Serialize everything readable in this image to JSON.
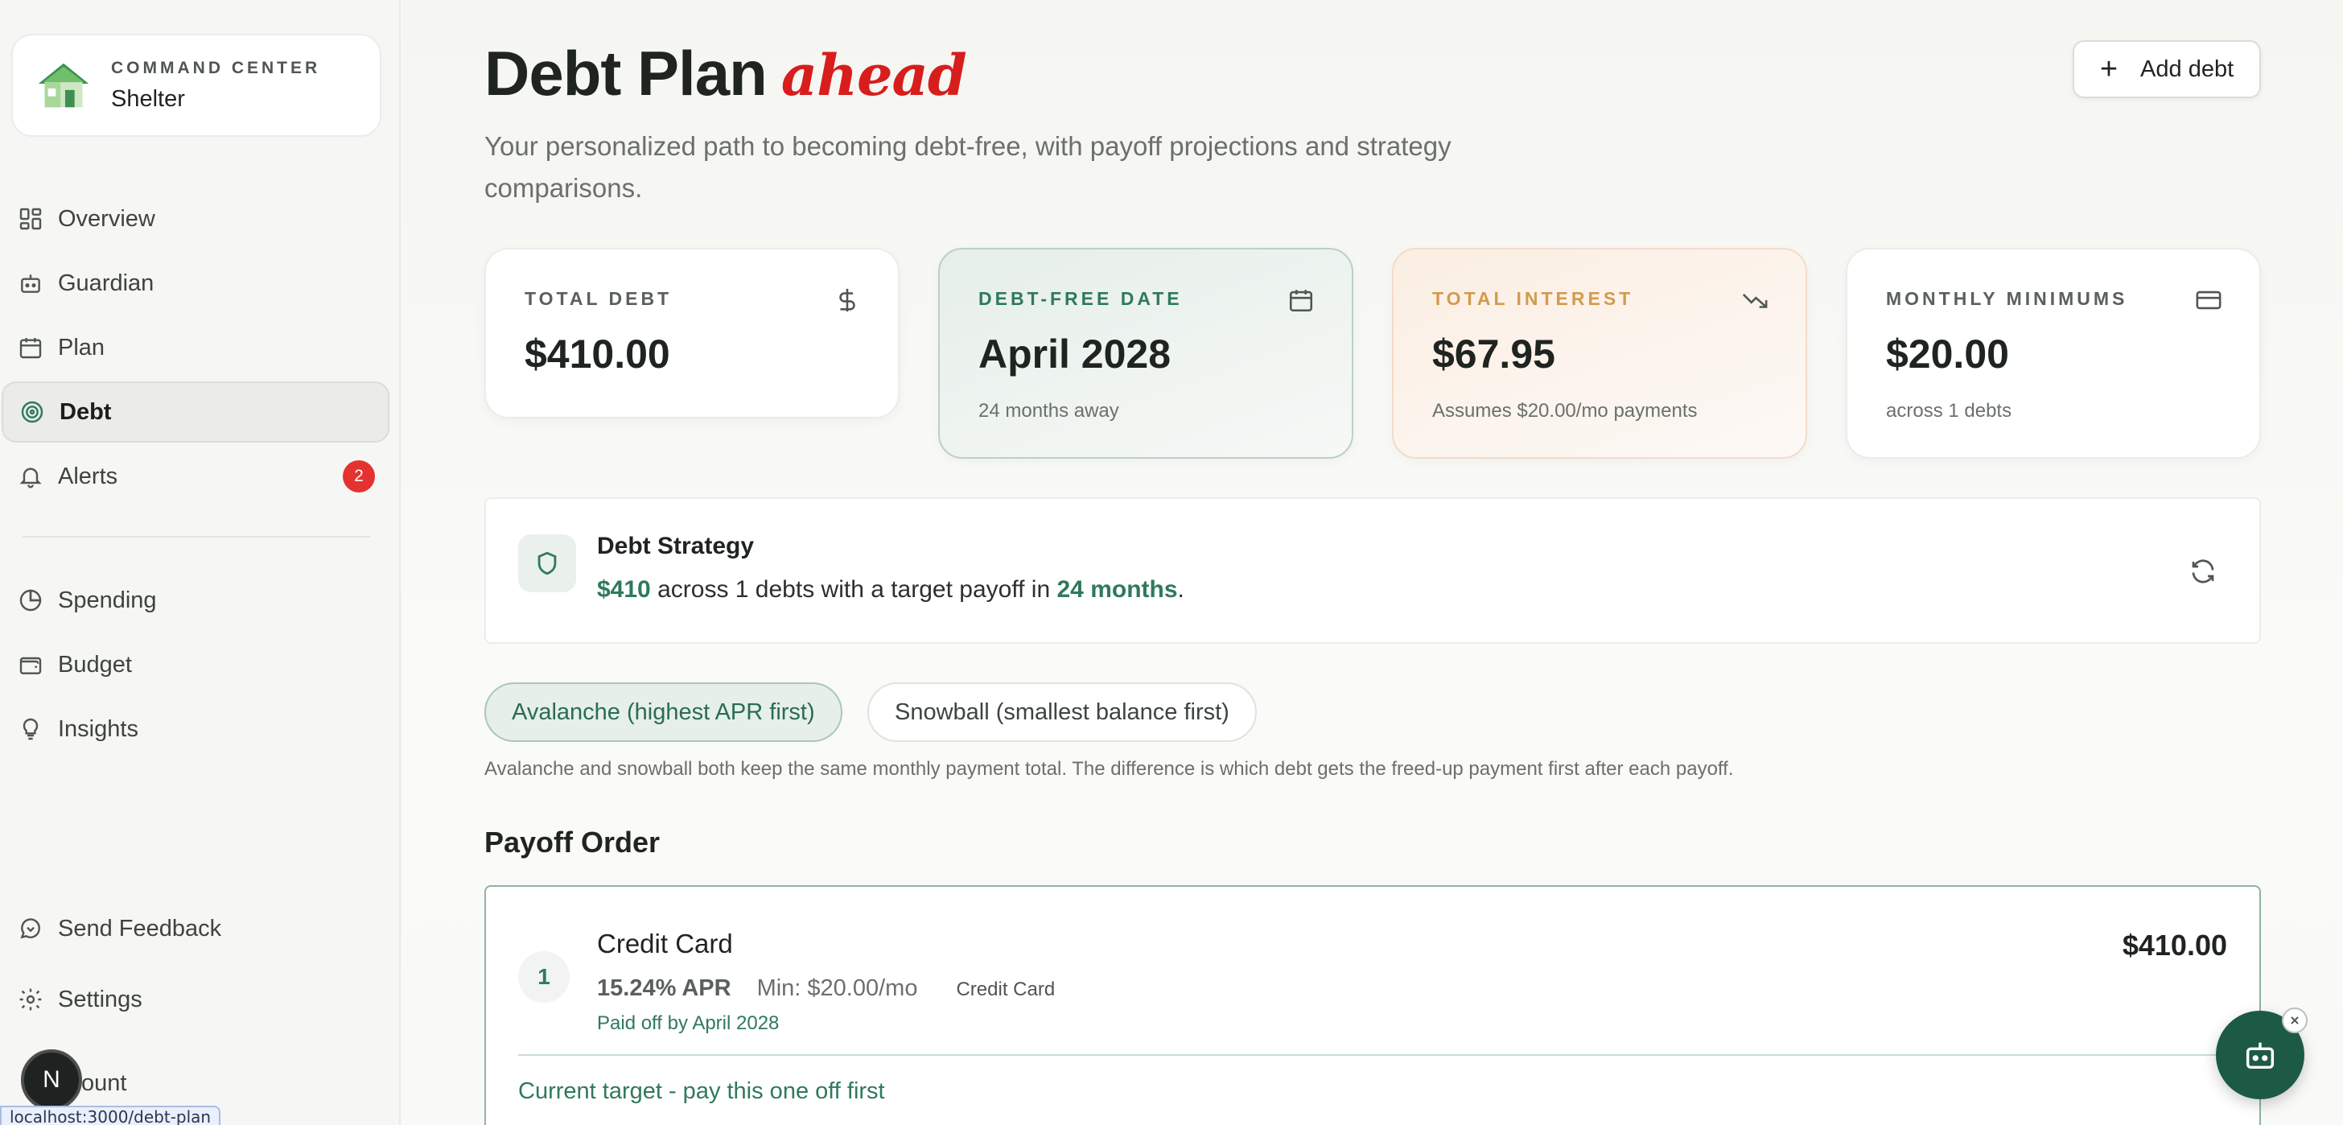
{
  "brand": {
    "kicker": "COMMAND CENTER",
    "name": "Shelter"
  },
  "sidebar": {
    "items": [
      {
        "label": "Overview",
        "icon": "grid-icon"
      },
      {
        "label": "Guardian",
        "icon": "robot-icon"
      },
      {
        "label": "Plan",
        "icon": "calendar-icon"
      },
      {
        "label": "Debt",
        "icon": "target-icon",
        "active": true
      },
      {
        "label": "Alerts",
        "icon": "bell-icon",
        "badge": "2"
      },
      {
        "label": "Spending",
        "icon": "pie-chart-icon"
      },
      {
        "label": "Budget",
        "icon": "wallet-icon"
      },
      {
        "label": "Insights",
        "icon": "lightbulb-icon"
      }
    ],
    "footer": [
      {
        "label": "Send Feedback",
        "icon": "feedback-icon"
      },
      {
        "label": "Settings",
        "icon": "gear-icon"
      },
      {
        "label": "ccount"
      }
    ],
    "avatar_letter": "N",
    "url_tooltip": "localhost:3000/debt-plan"
  },
  "header": {
    "title": "Debt Plan",
    "title_accent": "ahead",
    "subtitle": "Your personalized path to becoming debt-free, with payoff projections and strategy comparisons.",
    "add_label": "Add debt"
  },
  "stats": [
    {
      "label": "TOTAL DEBT",
      "value": "$410.00",
      "sub": "",
      "icon": "dollar-icon"
    },
    {
      "label": "DEBT-FREE DATE",
      "value": "April 2028",
      "sub": "24 months away",
      "icon": "calendar-icon"
    },
    {
      "label": "TOTAL INTEREST",
      "value": "$67.95",
      "sub": "Assumes $20.00/mo payments",
      "icon": "trending-down-icon"
    },
    {
      "label": "MONTHLY MINIMUMS",
      "value": "$20.00",
      "sub": "across 1 debts",
      "icon": "credit-card-icon"
    }
  ],
  "strategy": {
    "title": "Debt Strategy",
    "amount": "$410",
    "text_mid": " across 1 debts with a target payoff in ",
    "months": "24 months",
    "text_end": "."
  },
  "pills": {
    "avalanche": "Avalanche (highest APR first)",
    "snowball": "Snowball (smallest balance first)",
    "note": "Avalanche and snowball both keep the same monthly payment total. The difference is which debt gets the freed-up payment first after each payoff."
  },
  "payoff": {
    "title": "Payoff Order",
    "debts": [
      {
        "rank": "1",
        "name": "Credit Card",
        "amount": "$410.00",
        "apr": "15.24% APR",
        "min": "Min: $20.00/mo",
        "type": "Credit Card",
        "payoff": "Paid off by April 2028",
        "target": "Current target - pay this one off first"
      }
    ]
  },
  "colors": {
    "accent": "#2f7a5a",
    "badge": "#e5312f",
    "title_accent": "#d81d1d"
  }
}
